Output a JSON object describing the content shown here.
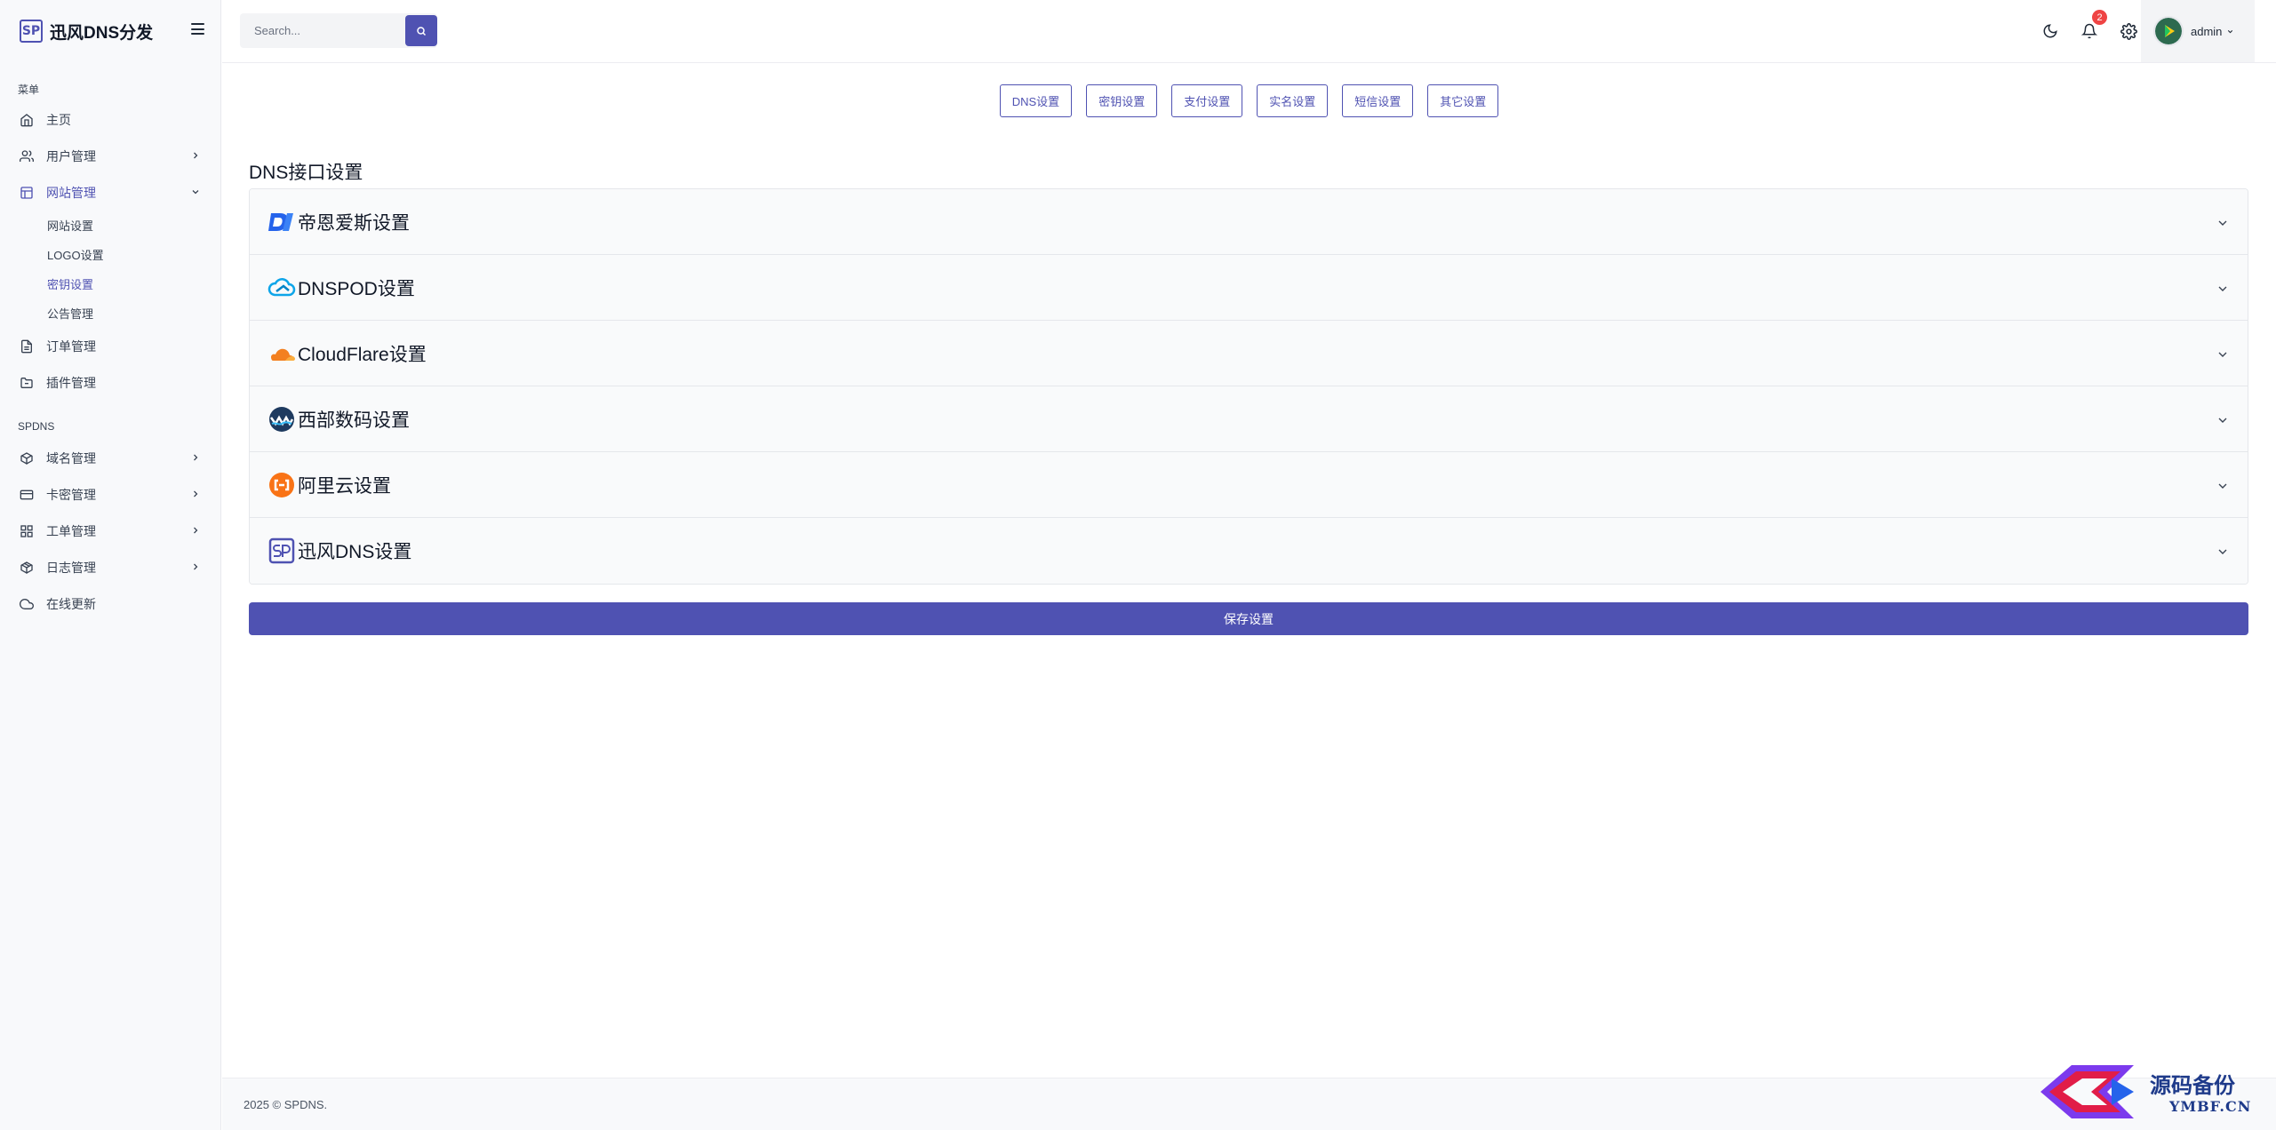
{
  "brand": {
    "logo_text": "SP",
    "name": "迅风DNS分发"
  },
  "sidebar": {
    "section_menu": "菜单",
    "section_spdns": "SPDNS",
    "items": [
      {
        "label": "主页",
        "icon": "home-icon"
      },
      {
        "label": "用户管理",
        "icon": "users-icon"
      },
      {
        "label": "网站管理",
        "icon": "layout-icon"
      },
      {
        "label": "订单管理",
        "icon": "file-icon"
      },
      {
        "label": "插件管理",
        "icon": "folder-icon"
      }
    ],
    "sub_items": [
      {
        "label": "网站设置"
      },
      {
        "label": "LOGO设置"
      },
      {
        "label": "密钥设置"
      },
      {
        "label": "公告管理"
      }
    ],
    "spdns_items": [
      {
        "label": "域名管理",
        "icon": "box-icon"
      },
      {
        "label": "卡密管理",
        "icon": "credit-card-icon"
      },
      {
        "label": "工单管理",
        "icon": "grid-icon"
      },
      {
        "label": "日志管理",
        "icon": "package-icon"
      },
      {
        "label": "在线更新",
        "icon": "cloud-icon"
      }
    ]
  },
  "topbar": {
    "search_placeholder": "Search...",
    "notification_count": "2",
    "username": "admin"
  },
  "tabs": [
    {
      "label": "DNS设置"
    },
    {
      "label": "密钥设置"
    },
    {
      "label": "支付设置"
    },
    {
      "label": "实名设置"
    },
    {
      "label": "短信设置"
    },
    {
      "label": "其它设置"
    }
  ],
  "main": {
    "section_title": "DNS接口设置",
    "providers": [
      {
        "label": "帝恩爱斯设置",
        "icon": "dns-la-logo-icon"
      },
      {
        "label": "DNSPOD设置",
        "icon": "dnspod-cloud-icon"
      },
      {
        "label": "CloudFlare设置",
        "icon": "cloudflare-icon"
      },
      {
        "label": "西部数码设置",
        "icon": "west-digital-icon"
      },
      {
        "label": "阿里云设置",
        "icon": "aliyun-icon"
      },
      {
        "label": "迅风DNS设置",
        "icon": "sp-logo-icon"
      }
    ],
    "save_label": "保存设置"
  },
  "footer": {
    "text": "2025 © SPDNS."
  },
  "watermark": {
    "title": "源码备份",
    "sub": "YMBF.CN"
  },
  "colors": {
    "accent": "#4f52b2",
    "badge": "#ef4444"
  }
}
